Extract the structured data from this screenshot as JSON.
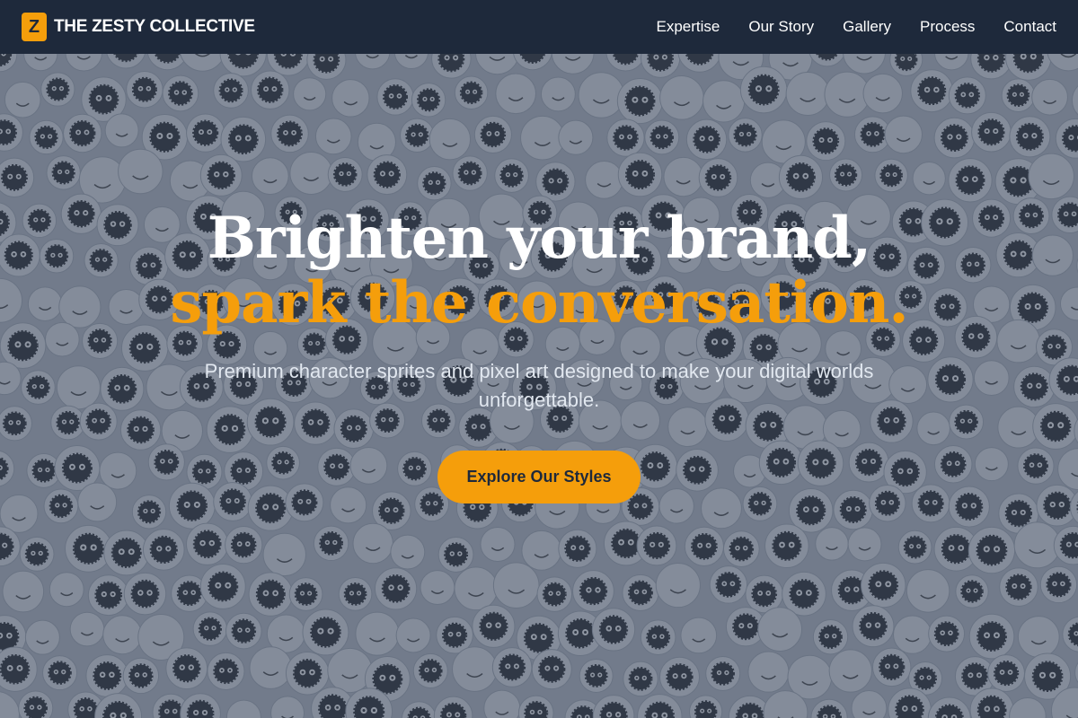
{
  "header": {
    "logo_letter": "Z",
    "brand_name": "THE ZESTY COLLECTIVE",
    "nav": [
      {
        "label": "Expertise"
      },
      {
        "label": "Our Story"
      },
      {
        "label": "Gallery"
      },
      {
        "label": "Process"
      },
      {
        "label": "Contact"
      }
    ]
  },
  "hero": {
    "headline_line1": "Brighten your brand,",
    "headline_line2": "spark the conversation.",
    "subtitle": "Premium character sprites and pixel art designed to make your digital worlds unforgettable.",
    "cta_label": "Explore Our Styles"
  },
  "colors": {
    "navbar_bg": "#1e293b",
    "accent": "#f59e0b",
    "text_light": "#ffffff"
  },
  "background": {
    "description_icon": "doodle-pattern"
  }
}
